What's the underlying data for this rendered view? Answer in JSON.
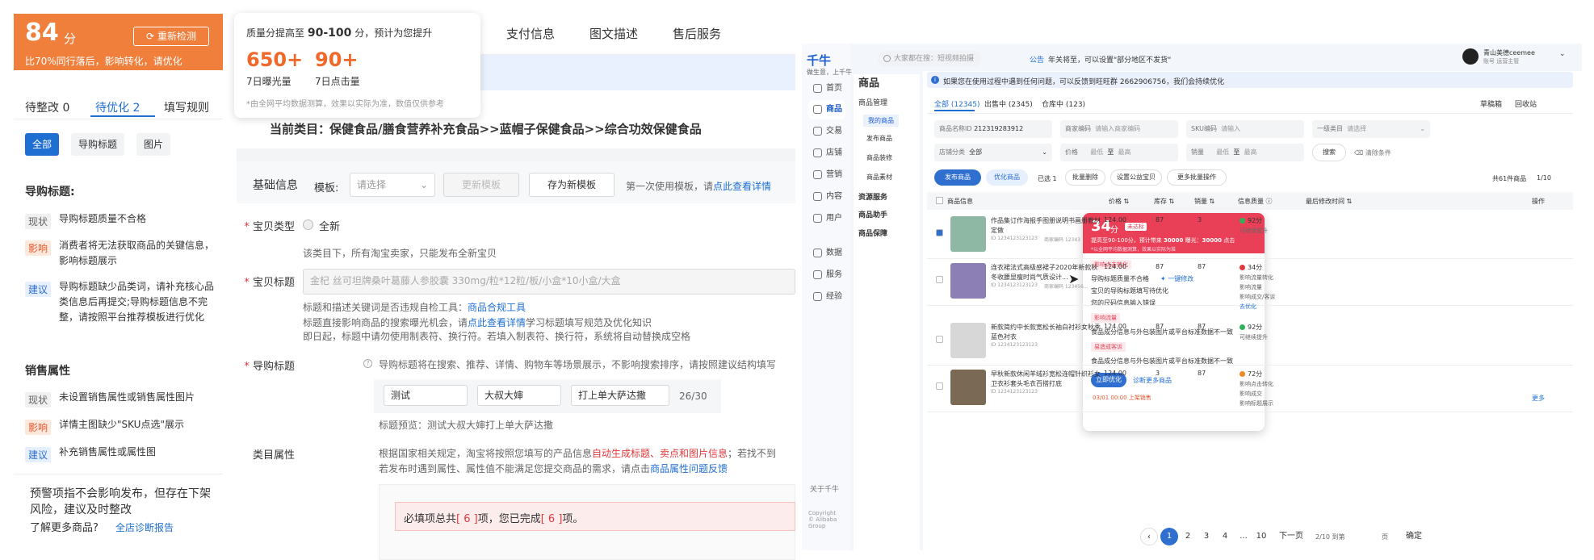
{
  "left": {
    "score": "84",
    "score_unit": "分",
    "recheck": "重新检测",
    "rank_note": "比70%同行落后，影响转化，请优化",
    "tabs": [
      "待整改 0",
      "待优化 2",
      "填写规则"
    ],
    "filters": [
      "全部",
      "导购标题",
      "图片"
    ],
    "sections": [
      {
        "title": "导购标题:",
        "rows": [
          {
            "tag": "现状",
            "text": "导购标题质量不合格"
          },
          {
            "tag": "影响",
            "text": "消费者将无法获取商品的关键信息，影响标题展示"
          },
          {
            "tag": "建议",
            "text": "导购标题缺少品类词，请补充核心品类信息后再提交;导购标题信息不完整，请按照平台推荐模板进行优化"
          }
        ]
      },
      {
        "title": "销售属性",
        "rows": [
          {
            "tag": "现状",
            "text": "未设置销售属性或销售属性图片"
          },
          {
            "tag": "影响",
            "text": "详情主图缺少\"SKU点选\"展示"
          },
          {
            "tag": "建议",
            "text": "补充销售属性或属性图"
          }
        ]
      }
    ],
    "footer": "预警项指不会影响发布，但存在下架风险，建议及时整改",
    "footer_more": "了解更多商品?",
    "footer_link": "全店诊断报告",
    "popup": {
      "line1": "质量分提高至",
      "range": "90-100",
      "line1b": "分，预计为您提升",
      "m1_value": "650+",
      "m1_label": "7日曝光量",
      "m2_value": "90+",
      "m2_label": "7日点击量",
      "note": "*由全网平均数据测算，效果以实际为准，数值仅供参考"
    },
    "form": {
      "tabs": [
        "支付信息",
        "图文描述",
        "售后服务"
      ],
      "category_label": "当前类目：",
      "category": "保健食品/膳食营养补充食品>>蓝帽子保健食品>>综合功效保健食品",
      "basic_title": "基础信息",
      "template_label": "模板:",
      "template_placeholder": "请选择",
      "update_tpl": "更新模板",
      "save_tpl": "存为新模板",
      "first_use": "第一次使用模板，请",
      "first_link": "点此查看详情",
      "type_label": "宝贝类型",
      "type_value": "全新",
      "type_note": "该类目下，所有淘宝卖家，只能发布全新宝贝",
      "title_label": "宝贝标题",
      "title_value": "金杞 丝可坦牌桑叶葛藤人参胶囊 330mg/粒*12粒/板/小盒*10小盒/大盒",
      "title_hint1": "标题和描述关键词是否违规自检工具：",
      "title_hint1_link": "商品合规工具",
      "title_hint2": "标题直接影响商品的搜索曝光机会，请",
      "title_hint2_link": "点此查看详情",
      "title_hint2b": "学习标题填写规范及优化知识",
      "title_hint3": "即日起，标题中请勿使用制表符、换行符。若填入制表符、换行符，系统将自动替换成空格",
      "guide_label": "导购标题",
      "guide_hint": "导购标题将在搜索、推荐、详情、购物车等场景展示，不影响搜索排序，请按照建议结构填写",
      "guide_inputs": [
        "测试",
        "大叔大婶",
        "打上单大萨达撒"
      ],
      "guide_count": "26/30",
      "guide_preview": "标题预览：测试大叔大婶打上单大萨达撒",
      "attr_label": "类目属性",
      "attr_hint1": "根据国家相关规定，淘宝将按照您填写的产品信息",
      "attr_hint1_red": "自动生成标题、卖点和图片信息",
      "attr_hint1b": "；若找不到",
      "attr_hint2": "若发布时遇到属性、属性值不能满足您提交商品的需求，请点击",
      "attr_hint2_link": "商品属性问题反馈",
      "required_a": "必填项总共",
      "required_n": "[ 6 ]",
      "required_b": "项，您已完成",
      "required_m": "[ 6 ]",
      "required_c": "项。"
    }
  },
  "right": {
    "logo": "千牛",
    "logo_sub": "做生意，上千牛",
    "search_placeholder": "大家都在搜：短视频拍摄",
    "notice_tag": "公告",
    "notice": "年关将至，可以设置\"部分地区不发货\"",
    "user_name": "青山美德ceemee",
    "user_sub": "账号 运营主管",
    "nav": [
      "首页",
      "商品",
      "交易",
      "店铺",
      "营销",
      "内容",
      "用户",
      "数据",
      "服务",
      "经验"
    ],
    "nav_about": "关于千牛",
    "copyright": "Copyright\n© Alibaba Group",
    "subnav_title": "商品",
    "subnav": [
      "商品管理",
      "我的商品",
      "发布商品",
      "商品装修",
      "商品素材",
      "资源服务",
      "商品助手",
      "商品保障"
    ],
    "banner": "如果您在使用过程中遇到任何问题，可以反馈到旺旺群 2662906756，我们会持续优化",
    "tabs": [
      "全部 (12345)",
      "出售中 (2345)",
      "仓库中 (123)"
    ],
    "tab_right": [
      "草稿箱",
      "回收站"
    ],
    "filters": {
      "id_label": "商品名称ID",
      "id_value": "212319283912",
      "code_label": "商家编码",
      "code_ph": "请输入商家编码",
      "sku_label": "SKU编码",
      "sku_ph": "请输入",
      "cat_label": "一级类目",
      "cat_ph": "请选择",
      "shop_label": "店铺分类",
      "shop_value": "全部",
      "price_label": "价格",
      "min": "最低",
      "to": "至",
      "max": "最高",
      "stock_label": "销量",
      "search": "搜索",
      "clear": "清除条件"
    },
    "actions": [
      "发布商品",
      "优化商品",
      "已选 1",
      "批量删除",
      "设置公益宝贝",
      "更多批量操作"
    ],
    "total": "共61件商品",
    "pages": "1/10",
    "columns": [
      "商品信息",
      "价格",
      "库存",
      "销量",
      "信息质量",
      "最后修改时间",
      "操作"
    ],
    "rows": [
      {
        "title": "作品集订作海报手图册说明书画册教材定做",
        "id": "ID 1234123123123",
        "code": "商家编码 12343",
        "price": "124.00",
        "stock": "87",
        "sales": "3",
        "quality": "92分",
        "qnote": "可继续提升",
        "qcolor": "#2fb15a"
      },
      {
        "title": "连衣裙法式高级感裙子2020年新款秋冬收腰显瘦时尚气质设计...",
        "id": "ID 1234123123123",
        "code": "商家编码 123456...",
        "price": "124.00",
        "stock": "87",
        "sales": "87",
        "quality": "34分",
        "qnote": "影响流量转化",
        "qcolor": "#e4393c",
        "qextra": [
          "影响流量",
          "影响成交/客诉",
          "去优化"
        ]
      },
      {
        "title": "新款简约中长款宽松长袖白衬衫女秋季蓝色衬衣",
        "id": "ID 1234123123123",
        "code": "",
        "price": "124.00",
        "stock": "87",
        "sales": "87",
        "quality": "92分",
        "qnote": "可继续提升",
        "qcolor": "#2fb15a"
      },
      {
        "title": "早秋新款休闲羊绒衫宽松连帽针织衫女卫衣衫套头毛衣百搭打底",
        "id": "ID 1234123123123",
        "code": "",
        "price": "124.00",
        "stock": "3",
        "sales": "87",
        "quality": "72分",
        "qnote": "影响点击转化",
        "qcolor": "#f08a24",
        "qextra": [
          "影响成交",
          "影响标题展示"
        ]
      }
    ],
    "pagination": [
      "1",
      "2",
      "3",
      "4",
      "...",
      "10",
      "下一页",
      "2/10 到第",
      "页",
      "确定"
    ],
    "card": {
      "score": "34",
      "unit": "分",
      "badge": "未达标",
      "sub1": "提高至90-100分，预计带来",
      "sub1b": "30000",
      "sub1c": "曝光：",
      "sub1d": "30000",
      "sub1e": "点击",
      "note": "*以全网平均数据测算，效果以实际为准",
      "groups": [
        {
          "tag": "影响点击转化",
          "lines": [
            "导购标题质量不合格",
            "宝贝的导购标题填写待优化",
            "您的尺码信息输入错误"
          ],
          "quick": "一键修改"
        },
        {
          "tag": "影响流量",
          "lines": [
            "食品成分信息与外包装图片或平台标准数据不一致"
          ]
        },
        {
          "tag": "易造成客诉",
          "lines": [
            "食品成分信息与外包装图片或平台标准数据不一致"
          ]
        }
      ],
      "btn": "立即优化",
      "link": "诊断更多商品"
    },
    "row4_time": "03/01 00:00 上架销售",
    "more": "更多"
  }
}
